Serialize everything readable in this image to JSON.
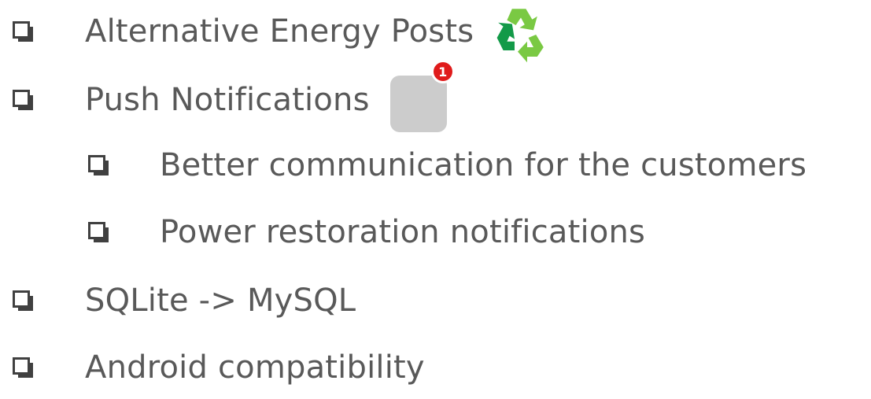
{
  "items": [
    {
      "label": "Alternative Energy Posts",
      "checked": false,
      "icon": "recycle-icon"
    },
    {
      "label": "Push Notifications",
      "checked": false,
      "icon": "app-notification-icon",
      "badge": "1"
    },
    {
      "label": "Better communication for the customers",
      "checked": false
    },
    {
      "label": "Power restoration notifications",
      "checked": false
    },
    {
      "label": "SQLite -> MySQL",
      "checked": false
    },
    {
      "label": "Android compatibility",
      "checked": false
    }
  ],
  "colors": {
    "text": "#595959",
    "checkbox": "#404040",
    "recycle_light": "#7ac943",
    "recycle_dark": "#139a48",
    "badge": "#e01b1b",
    "app_tile": "#cccccc"
  }
}
